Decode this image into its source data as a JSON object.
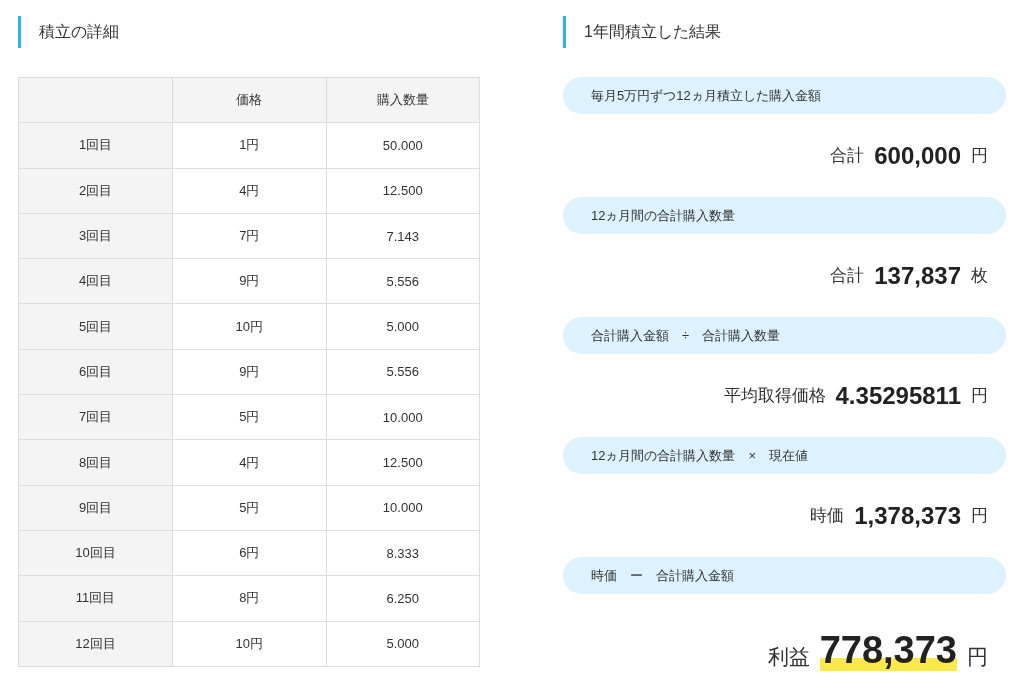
{
  "details": {
    "title": "積立の詳細",
    "columns": [
      "",
      "価格",
      "購入数量"
    ],
    "rows": [
      [
        "1回目",
        "1円",
        "50.000"
      ],
      [
        "2回目",
        "4円",
        "12.500"
      ],
      [
        "3回目",
        "7円",
        "7.143"
      ],
      [
        "4回目",
        "9円",
        "5.556"
      ],
      [
        "5回目",
        "10円",
        "5.000"
      ],
      [
        "6回目",
        "9円",
        "5.556"
      ],
      [
        "7回目",
        "5円",
        "10.000"
      ],
      [
        "8回目",
        "4円",
        "12.500"
      ],
      [
        "9回目",
        "5円",
        "10.000"
      ],
      [
        "10回目",
        "6円",
        "8.333"
      ],
      [
        "11回目",
        "8円",
        "6.250"
      ],
      [
        "12回目",
        "10円",
        "5.000"
      ]
    ]
  },
  "results": {
    "title": "1年間積立した結果",
    "items": [
      {
        "label": "毎月5万円ずつ12ヵ月積立した購入金額",
        "prefix": "合計",
        "value": "600,000",
        "unit": "円",
        "highlighted": false
      },
      {
        "label": "12ヵ月間の合計購入数量",
        "prefix": "合計",
        "value": "137,837",
        "unit": "枚",
        "highlighted": false
      },
      {
        "label": "合計購入金額　÷　合計購入数量",
        "prefix": "平均取得価格",
        "value": "4.35295811",
        "unit": "円",
        "highlighted": false
      },
      {
        "label": "12ヵ月間の合計購入数量　×　現在値",
        "prefix": "時価",
        "value": "1,378,373",
        "unit": "円",
        "highlighted": false
      },
      {
        "label": "時価　ー　合計購入金額",
        "prefix": "利益",
        "value": "778,373",
        "unit": "円",
        "highlighted": true
      }
    ]
  }
}
